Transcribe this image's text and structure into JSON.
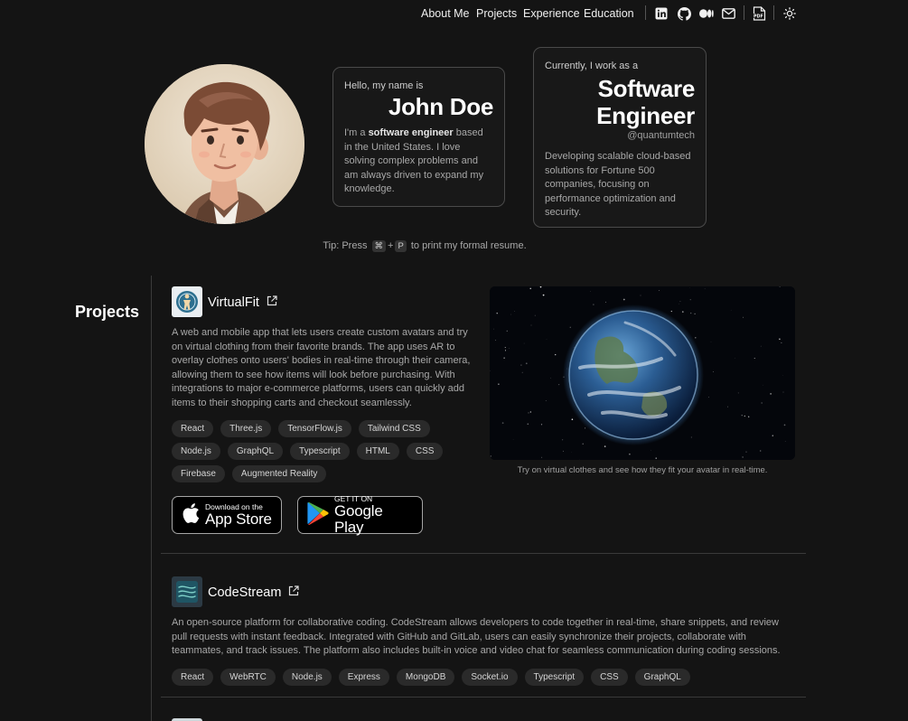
{
  "nav": {
    "links": [
      "About Me",
      "Projects",
      "Experience",
      "Education"
    ],
    "icons": [
      "linkedin-icon",
      "github-icon",
      "medium-icon",
      "mail-icon",
      "pdf-icon",
      "theme-toggle-icon"
    ]
  },
  "hero": {
    "greeting": "Hello, my name is",
    "name": "John Doe",
    "intro_prefix": "I'm a ",
    "intro_bold": "software engineer",
    "intro_suffix": " based in the United States. I love solving complex problems and am always driven to expand my knowledge.",
    "work_label": "Currently, I work as a",
    "role_line1": "Software",
    "role_line2": "Engineer",
    "company": "@quantumtech",
    "work_desc": "Developing scalable cloud-based solutions for Fortune 500 companies, focusing on performance optimization and security."
  },
  "tip": {
    "prefix": "Tip: Press",
    "key1": "⌘",
    "plus": "+",
    "key2": "P",
    "suffix": "to print my formal resume."
  },
  "projects": {
    "section_title": "Projects",
    "items": [
      {
        "title": "VirtualFit",
        "description": "A web and mobile app that lets users create custom avatars and try on virtual clothing from their favorite brands. The app uses AR to overlay clothes onto users' bodies in real-time through their camera, allowing them to see how items will look before purchasing. With integrations to major e-commerce platforms, users can quickly add items to their shopping carts and checkout seamlessly.",
        "tags": [
          "React",
          "Three.js",
          "TensorFlow.js",
          "Tailwind CSS",
          "Node.js",
          "GraphQL",
          "Typescript",
          "HTML",
          "CSS",
          "Firebase",
          "Augmented Reality"
        ],
        "appstore_small": "Download on the",
        "appstore_big": "App Store",
        "play_small": "GET IT ON",
        "play_big": "Google Play",
        "caption": "Try on virtual clothes and see how they fit your avatar in real-time."
      },
      {
        "title": "CodeStream",
        "description": "An open-source platform for collaborative coding. CodeStream allows developers to code together in real-time, share snippets, and review pull requests with instant feedback. Integrated with GitHub and GitLab, users can easily synchronize their projects, collaborate with teammates, and track issues. The platform also includes built-in voice and video chat for seamless communication during coding sessions.",
        "tags": [
          "React",
          "WebRTC",
          "Node.js",
          "Express",
          "MongoDB",
          "Socket.io",
          "Typescript",
          "CSS",
          "GraphQL"
        ]
      }
    ]
  }
}
